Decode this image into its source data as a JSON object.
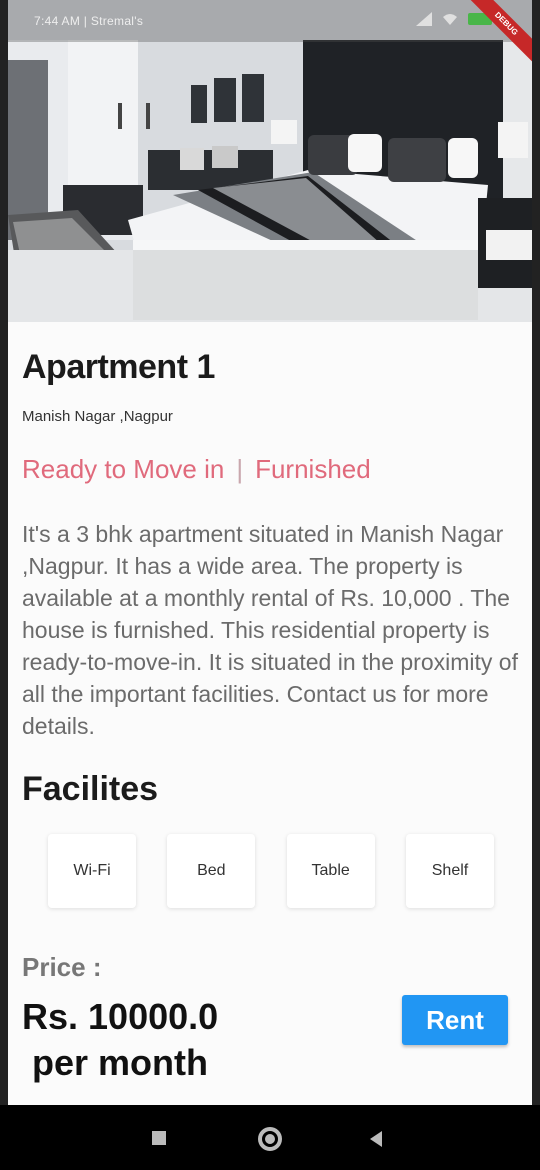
{
  "status_bar": {
    "time": "7:44 AM",
    "carrier": "Stremal's",
    "debug_label": "DEBUG"
  },
  "hero": {
    "icon": "bedroom-photo"
  },
  "property": {
    "title": "Apartment 1",
    "location": "Manish Nagar ,Nagpur",
    "tag_ready": "Ready to Move in",
    "tag_separator": "|",
    "tag_furnished": "Furnished",
    "description": "It's a 3 bhk apartment situated in Manish Nagar ,Nagpur. It has a wide area. The property is available at a monthly rental of Rs. 10,000 . The house is furnished. This residential property is ready-to-move-in. It is situated in the proximity of all the important facilities. Contact us for more details."
  },
  "facilities": {
    "title": "Facilites",
    "items": [
      {
        "label": "Wi-Fi"
      },
      {
        "label": "Bed"
      },
      {
        "label": "Table"
      },
      {
        "label": "Shelf"
      }
    ]
  },
  "pricing": {
    "label": "Price :",
    "value": "Rs. 10000.0",
    "unit": "per month",
    "rent_button": "Rent"
  },
  "colors": {
    "accent": "#2196f3",
    "tag": "#e06a7c"
  }
}
